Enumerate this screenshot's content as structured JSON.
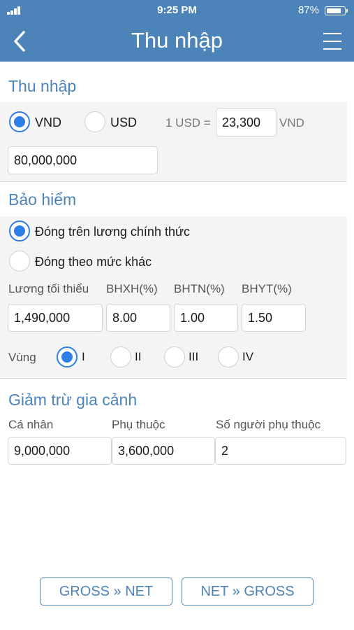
{
  "status_bar": {
    "time": "9:25 PM",
    "battery_percent": "87%",
    "battery_level": 0.87
  },
  "nav": {
    "title": "Thu nhập",
    "back_icon": "chevron-left-icon",
    "menu_icon": "hamburger-menu-icon"
  },
  "income": {
    "title": "Thu nhập",
    "currency_options": [
      {
        "label": "VND",
        "selected": true
      },
      {
        "label": "USD",
        "selected": false
      }
    ],
    "rate_prefix": "1 USD =",
    "rate_value": "23,300",
    "rate_suffix": "VND",
    "amount": "80,000,000"
  },
  "insurance": {
    "title": "Bảo hiểm",
    "options": [
      {
        "label": "Đóng trên lương chính thức",
        "selected": true
      },
      {
        "label": "Đóng theo mức khác",
        "selected": false
      }
    ],
    "columns": {
      "min_wage_label": "Lương tối thiểu",
      "bhxh_label": "BHXH(%)",
      "bhtn_label": "BHTN(%)",
      "bhyt_label": "BHYT(%)"
    },
    "values": {
      "min_wage": "1,490,000",
      "bhxh": "8.00",
      "bhtn": "1.00",
      "bhyt": "1.50"
    },
    "region_label": "Vùng",
    "regions": [
      {
        "label": "I",
        "selected": true
      },
      {
        "label": "II",
        "selected": false
      },
      {
        "label": "III",
        "selected": false
      },
      {
        "label": "IV",
        "selected": false
      }
    ]
  },
  "deduction": {
    "title": "Giảm trừ gia cảnh",
    "personal_label": "Cá nhân",
    "dependent_label": "Phụ thuộc",
    "dependent_count_label": "Số người phụ thuộc",
    "personal_value": "9,000,000",
    "dependent_value": "3,600,000",
    "dependent_count_value": "2"
  },
  "actions": {
    "gross_to_net": "GROSS » NET",
    "net_to_gross": "NET » GROSS"
  },
  "colors": {
    "primary": "#4c84b9",
    "radio_active": "#2f7ee6",
    "panel_bg": "#f4f4f4"
  }
}
